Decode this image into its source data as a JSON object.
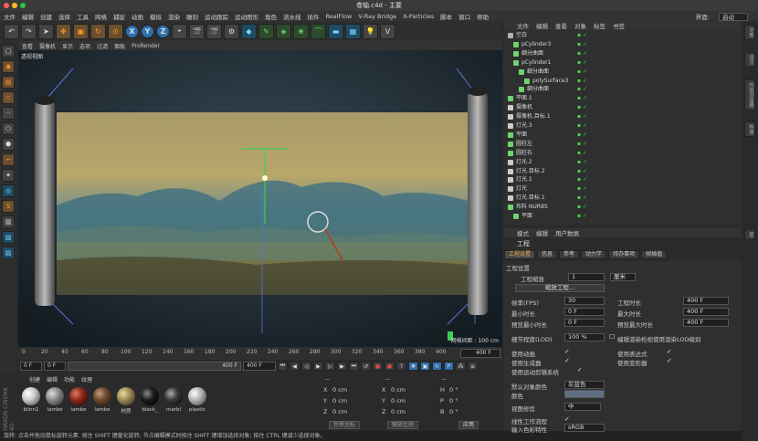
{
  "window": {
    "title": "卷轴.c4d - 主要"
  },
  "menubar": {
    "items": [
      "文件",
      "编辑",
      "创建",
      "选择",
      "工具",
      "网格",
      "捕捉",
      "动画",
      "模拟",
      "渲染",
      "雕刻",
      "运动跟踪",
      "运动图形",
      "角色",
      "流水线",
      "插件",
      "RealFlow",
      "V-Ray Bridge",
      "X-Particles",
      "脚本",
      "窗口",
      "帮助"
    ],
    "layout_label": "界面:",
    "layout_value": "启动"
  },
  "toolbar": {
    "axis_x": "X",
    "axis_y": "Y",
    "axis_z": "Z"
  },
  "viewport": {
    "menu": [
      "查看",
      "摄像机",
      "显示",
      "选项",
      "过滤",
      "面板",
      "ProRender"
    ],
    "view_label": "透视视图",
    "grid_label": "网格间距 : 100 cm"
  },
  "timeline": {
    "ticks": [
      "0",
      "20",
      "40",
      "60",
      "80",
      "100",
      "120",
      "140",
      "160",
      "180",
      "200",
      "220",
      "240",
      "260",
      "280",
      "300",
      "320",
      "340",
      "360",
      "380",
      "400"
    ],
    "current_frame": "400 F"
  },
  "transport": {
    "start": "0 F",
    "pos": "0 F",
    "end": "400 F",
    "end2": "400 F"
  },
  "materials": {
    "menu": [
      "创建",
      "编辑",
      "功能",
      "纹理"
    ],
    "items": [
      {
        "name": "blinn1",
        "color": "#c9c9c9"
      },
      {
        "name": "lambe",
        "color": "#8a8a8a"
      },
      {
        "name": "lambe",
        "color": "#8c2a1e"
      },
      {
        "name": "lambe",
        "color": "#6b4a32"
      },
      {
        "name": "材质",
        "color": "#9a8a5a"
      },
      {
        "name": "black_",
        "color": "#1b1b1b"
      },
      {
        "name": "marbl",
        "color": "#3a3a3a"
      },
      {
        "name": "plastic",
        "color": "#b5b5b5"
      }
    ],
    "brand": "MAXON CINEMA 4D"
  },
  "coords": {
    "headers": [
      "--",
      "--",
      "--"
    ],
    "rows": [
      {
        "a": "X",
        "av": "0 cm",
        "b": "X",
        "bv": "0 cm",
        "c": "H",
        "cv": "0 °"
      },
      {
        "a": "Y",
        "av": "0 cm",
        "b": "Y",
        "bv": "0 cm",
        "c": "P",
        "cv": "0 °"
      },
      {
        "a": "Z",
        "av": "0 cm",
        "b": "Z",
        "bv": "0 cm",
        "c": "B",
        "cv": "0 °"
      }
    ],
    "mode": "世界坐标",
    "scale": "缩放比例",
    "apply": "应用"
  },
  "status": "旋转: 点击并拖动鼠标旋转元素. 按住 SHIFT 键量化旋转; 节点编辑模式时按住 SHIFT 键增加选择对象; 按住 CTRL 键减少选择对象。",
  "object_manager": {
    "menu": [
      "文件",
      "编辑",
      "查看",
      "对象",
      "标签",
      "书签"
    ],
    "rows": [
      {
        "indent": 0,
        "name": "空白",
        "icon": "#b0b0b0"
      },
      {
        "indent": 1,
        "name": "pCylinder3",
        "icon": "#6fd36f"
      },
      {
        "indent": 1,
        "name": "细分曲面",
        "icon": "#6fd36f"
      },
      {
        "indent": 1,
        "name": "pCylinder1",
        "icon": "#6fd36f"
      },
      {
        "indent": 2,
        "name": "细分曲面",
        "icon": "#6fd36f"
      },
      {
        "indent": 3,
        "name": "polySurface3",
        "icon": "#6fd36f"
      },
      {
        "indent": 2,
        "name": "细分曲面",
        "icon": "#6fd36f"
      },
      {
        "indent": 0,
        "name": "平面.1",
        "icon": "#6fd36f"
      },
      {
        "indent": 0,
        "name": "摄像机",
        "icon": "#cccccc"
      },
      {
        "indent": 0,
        "name": "摄像机.目标.1",
        "icon": "#cccccc"
      },
      {
        "indent": 0,
        "name": "灯光.3",
        "icon": "#cccccc"
      },
      {
        "indent": 0,
        "name": "平面",
        "icon": "#6fd36f"
      },
      {
        "indent": 0,
        "name": "圆柱左",
        "icon": "#6fd36f"
      },
      {
        "indent": 0,
        "name": "圆柱右",
        "icon": "#6fd36f"
      },
      {
        "indent": 0,
        "name": "灯光.2",
        "icon": "#cccccc"
      },
      {
        "indent": 0,
        "name": "灯光.目标.2",
        "icon": "#cccccc"
      },
      {
        "indent": 0,
        "name": "灯光.1",
        "icon": "#cccccc"
      },
      {
        "indent": 0,
        "name": "灯光",
        "icon": "#cccccc"
      },
      {
        "indent": 0,
        "name": "灯光.目标.1",
        "icon": "#cccccc"
      },
      {
        "indent": 0,
        "name": "布料 NURBS",
        "icon": "#6fd36f"
      },
      {
        "indent": 1,
        "name": "平面",
        "icon": "#6fd36f"
      }
    ]
  },
  "side_tabs": [
    "对象",
    "场次",
    "内容浏览器",
    "构造",
    "层"
  ],
  "attributes": {
    "menu": [
      "模式",
      "编辑",
      "用户数据"
    ],
    "title": "工程",
    "tabs": [
      "工程设置",
      "信息",
      "参考",
      "动力学",
      "待办事项",
      "帧插值"
    ],
    "section": "工程设置",
    "scale_label": "工程缩放",
    "scale_value": "1",
    "scale_unit": "厘米",
    "scale_button": "缩放工程...",
    "fps_label": "帧率(FPS)",
    "fps_value": "30",
    "length_label": "工程时长",
    "length_value": "400 F",
    "min_label": "最小时长",
    "min_value": "0 F",
    "max_label": "最大时长",
    "max_value": "400 F",
    "pmin_label": "预览最小时长",
    "pmin_value": "0 F",
    "pmax_label": "预览最大时长",
    "pmax_value": "400 F",
    "lod_label": "细节程度(LOD)",
    "lod_value": "100 %",
    "lod_check": "编辑渲染检视使用渲染LOD级别",
    "anim_label": "使用动画",
    "expr_label": "使用表达式",
    "gen_label": "使用生成器",
    "deform_label": "使用变形器",
    "motion_label": "使用运动剪辑系统",
    "objcolor_label": "默认对象颜色",
    "objcolor_value": "灰蓝色",
    "color_label": "颜色",
    "clip_label": "视图修剪",
    "clip_value": "中",
    "linear_label": "线性工作流程",
    "input_label": "输入色彩特性",
    "input_value": "sRGB"
  }
}
